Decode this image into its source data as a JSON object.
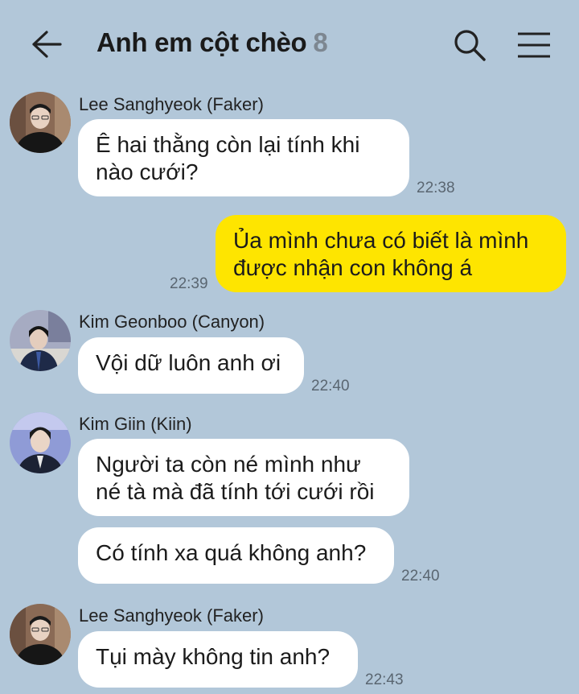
{
  "header": {
    "title": "Anh em cột chèo",
    "member_count": "8"
  },
  "icons": {
    "back": "arrow-left-icon",
    "search": "search-icon",
    "menu": "hamburger-menu-icon"
  },
  "colors": {
    "background": "#b2c7d9",
    "incoming_bubble": "#ffffff",
    "outgoing_bubble": "#fee500",
    "member_count": "#7d8791"
  },
  "messages": [
    {
      "sender": "Lee Sanghyeok (Faker)",
      "lines": [
        "Ê hai thằng còn lại tính khi",
        "nào cưới?"
      ],
      "time": "22:38"
    },
    {
      "sender": "me",
      "lines": [
        "Ủa mình chưa có biết là mình",
        "được nhận con không á"
      ],
      "time": "22:39"
    },
    {
      "sender": "Kim Geonboo (Canyon)",
      "lines": [
        "Vội dữ luôn anh ơi"
      ],
      "time": "22:40"
    },
    {
      "sender": "Kim Giin (Kiin)",
      "lines": [
        "Người ta còn né mình như",
        "né tà mà đã tính tới cưới rồi"
      ]
    },
    {
      "sender": "Kim Giin (Kiin)",
      "lines": [
        "Có tính xa quá không anh?"
      ],
      "time": "22:40"
    },
    {
      "sender": "Lee Sanghyeok (Faker)",
      "lines": [
        "Tụi mày không tin anh?"
      ],
      "time": "22:43"
    }
  ]
}
